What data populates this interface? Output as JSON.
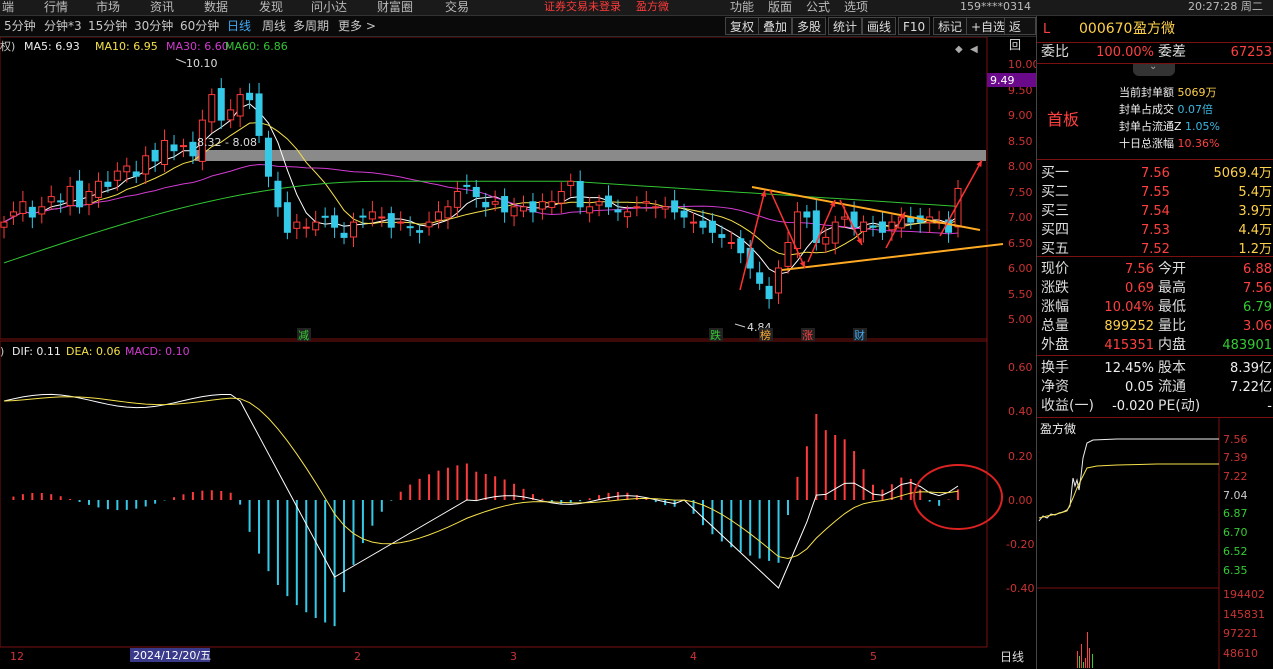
{
  "top_menu": {
    "items": [
      "端",
      "行情",
      "市场",
      "资讯",
      "数据",
      "发现",
      "问小达",
      "财富圈",
      "交易"
    ],
    "login_notice": "证券交易未登录",
    "stock_name": "盈方微",
    "right_items": [
      "功能",
      "版面",
      "公式",
      "选项"
    ],
    "user": "159****0314",
    "clock": "20:27:28 周二"
  },
  "period_bar": {
    "tabs": [
      "5分钟",
      "分钟*3",
      "15分钟",
      "30分钟",
      "60分钟",
      "日线",
      "周线",
      "多周期",
      "更多 >"
    ],
    "active": "日线",
    "tools": [
      "复权",
      "叠加",
      "多股",
      "统计",
      "画线",
      "F10",
      "标记",
      "+自选",
      "返回"
    ]
  },
  "main_chart": {
    "legend_prefix": "权)",
    "ma5": "MA5: 6.93",
    "ma10": "MA10: 6.95",
    "ma30": "MA30: 6.60",
    "ma60": "MA60: 6.86",
    "high_label": "10.10",
    "low_label": "4.84",
    "gap_label": "8.32 - 8.08",
    "price_tag": "9.49",
    "y_ticks": [
      "10.00",
      "9.50",
      "9.00",
      "8.50",
      "8.00",
      "7.50",
      "7.00",
      "6.50",
      "6.00",
      "5.50",
      "5.00"
    ],
    "event_tags": [
      "减",
      "跌",
      "榜",
      "涨",
      "财"
    ]
  },
  "macd": {
    "legend_prefix": ")",
    "dif": "DIF: 0.11",
    "dea": "DEA: 0.06",
    "macd": "MACD: 0.10",
    "y_ticks": [
      "0.60",
      "0.40",
      "0.20",
      "0.00",
      "-0.20",
      "-0.40"
    ]
  },
  "date_axis": {
    "labels": [
      "12",
      "2024/12/20/五",
      "2",
      "3",
      "4",
      "5"
    ],
    "period": "日线"
  },
  "quote": {
    "flag": "L",
    "code": "000670",
    "name": "盈方微",
    "weibi_label": "委比",
    "weibi": "100.00%",
    "weicha_label": "委差",
    "weicha": "67253",
    "board": "首板",
    "seal": [
      {
        "label": "当前封单额",
        "value": "5069万"
      },
      {
        "label": "封单占成交",
        "value": "0.07倍"
      },
      {
        "label": "封单占流通Z",
        "value": "1.05%"
      },
      {
        "label": "十日总涨幅",
        "value": "10.36%"
      }
    ],
    "book": [
      {
        "label": "买一",
        "price": "7.56",
        "vol": "5069.4万"
      },
      {
        "label": "买二",
        "price": "7.55",
        "vol": "5.4万"
      },
      {
        "label": "买三",
        "price": "7.54",
        "vol": "3.9万"
      },
      {
        "label": "买四",
        "price": "7.53",
        "vol": "4.4万"
      },
      {
        "label": "买五",
        "price": "7.52",
        "vol": "1.2万"
      }
    ],
    "stats": [
      {
        "l1": "现价",
        "v1": "7.56",
        "c1": "red",
        "l2": "今开",
        "v2": "6.88",
        "c2": "red"
      },
      {
        "l1": "涨跌",
        "v1": "0.69",
        "c1": "red",
        "l2": "最高",
        "v2": "7.56",
        "c2": "red"
      },
      {
        "l1": "涨幅",
        "v1": "10.04%",
        "c1": "red",
        "l2": "最低",
        "v2": "6.79",
        "c2": "green"
      },
      {
        "l1": "总量",
        "v1": "899252",
        "c1": "yellow",
        "l2": "量比",
        "v2": "3.06",
        "c2": "red"
      },
      {
        "l1": "外盘",
        "v1": "415351",
        "c1": "red",
        "l2": "内盘",
        "v2": "483901",
        "c2": "green"
      },
      {
        "l1": "换手",
        "v1": "12.45%",
        "c1": "white",
        "l2": "股本",
        "v2": "8.39亿",
        "c2": "white"
      },
      {
        "l1": "净资",
        "v1": "0.05",
        "c1": "white",
        "l2": "流通",
        "v2": "7.22亿",
        "c2": "white"
      },
      {
        "l1": "收益(一)",
        "v1": "-0.020",
        "c1": "white",
        "l2": "PE(动)",
        "v2": "-",
        "c2": "white"
      }
    ]
  },
  "mini_chart": {
    "title": "盈方微",
    "price_ticks": [
      "7.56",
      "7.39",
      "7.22",
      "7.04",
      "6.87",
      "6.70",
      "6.52",
      "6.35"
    ],
    "vol_ticks": [
      "194402",
      "145831",
      "97221",
      "48610"
    ]
  },
  "colors": {
    "up": "#ff3b3b",
    "down": "#35c9e8",
    "ma5": "#ffffff",
    "ma10": "#f5e14a",
    "ma30": "#d23bd2",
    "ma60": "#33c433",
    "accent": "#3fa9f5"
  }
}
